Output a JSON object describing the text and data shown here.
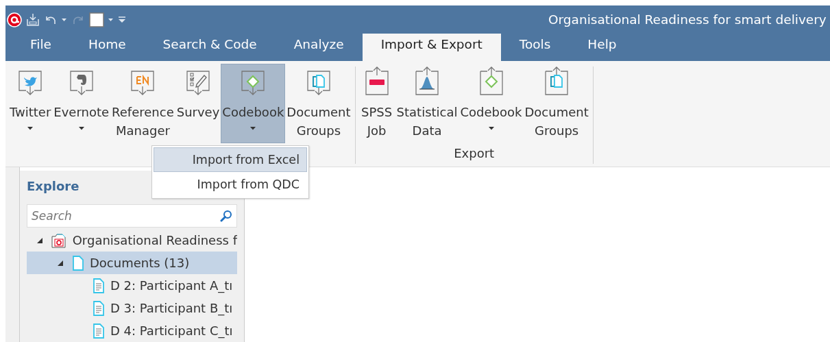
{
  "window": {
    "title": "Organisational Readiness for smart delivery"
  },
  "tabs": [
    {
      "label": "File",
      "selected": false
    },
    {
      "label": "Home",
      "selected": false
    },
    {
      "label": "Search & Code",
      "selected": false
    },
    {
      "label": "Analyze",
      "selected": false
    },
    {
      "label": "Import & Export",
      "selected": true
    },
    {
      "label": "Tools",
      "selected": false
    },
    {
      "label": "Help",
      "selected": false
    }
  ],
  "ribbon": {
    "groups": [
      {
        "buttons": [
          {
            "kind": "twitter",
            "label": "Twitter",
            "dropdown": true,
            "selected": false
          },
          {
            "kind": "evernote",
            "label": "Evernote",
            "dropdown": true,
            "selected": false
          },
          {
            "kind": "reference",
            "label": "Reference Manager",
            "dropdown": false,
            "selected": false
          },
          {
            "kind": "survey",
            "label": "Survey",
            "dropdown": false,
            "selected": false
          },
          {
            "kind": "codebook-import",
            "label": "Codebook",
            "dropdown": true,
            "selected": true
          },
          {
            "kind": "groups-import",
            "label": "Document Groups",
            "dropdown": false,
            "selected": false
          }
        ]
      },
      {
        "label": "Export",
        "buttons": [
          {
            "kind": "spss",
            "label": "SPSS Job",
            "dropdown": false,
            "selected": false
          },
          {
            "kind": "statistical",
            "label": "Statistical Data",
            "dropdown": false,
            "selected": false
          },
          {
            "kind": "codebook-export",
            "label": "Codebook",
            "dropdown": true,
            "selected": false
          },
          {
            "kind": "groups-export",
            "label": "Document Groups",
            "dropdown": false,
            "selected": false
          }
        ]
      }
    ]
  },
  "menu": {
    "items": [
      {
        "label": "Import from Excel",
        "selected": true
      },
      {
        "label": "Import from QDC",
        "selected": false
      }
    ]
  },
  "explore": {
    "title": "Explore",
    "search": {
      "placeholder": "Search"
    },
    "tree": [
      {
        "kind": "project",
        "label": "Organisational Readiness f",
        "expanded": true,
        "selected": false,
        "children": [
          {
            "kind": "folder",
            "label": "Documents (13)",
            "expanded": true,
            "selected": true,
            "children": [
              {
                "kind": "document",
                "label": "D 2: Participant A_tı",
                "selected": false
              },
              {
                "kind": "document",
                "label": "D 3: Participant B_tı",
                "selected": false
              },
              {
                "kind": "document",
                "label": "D 4: Participant C_tı",
                "selected": false
              }
            ]
          }
        ]
      }
    ]
  }
}
